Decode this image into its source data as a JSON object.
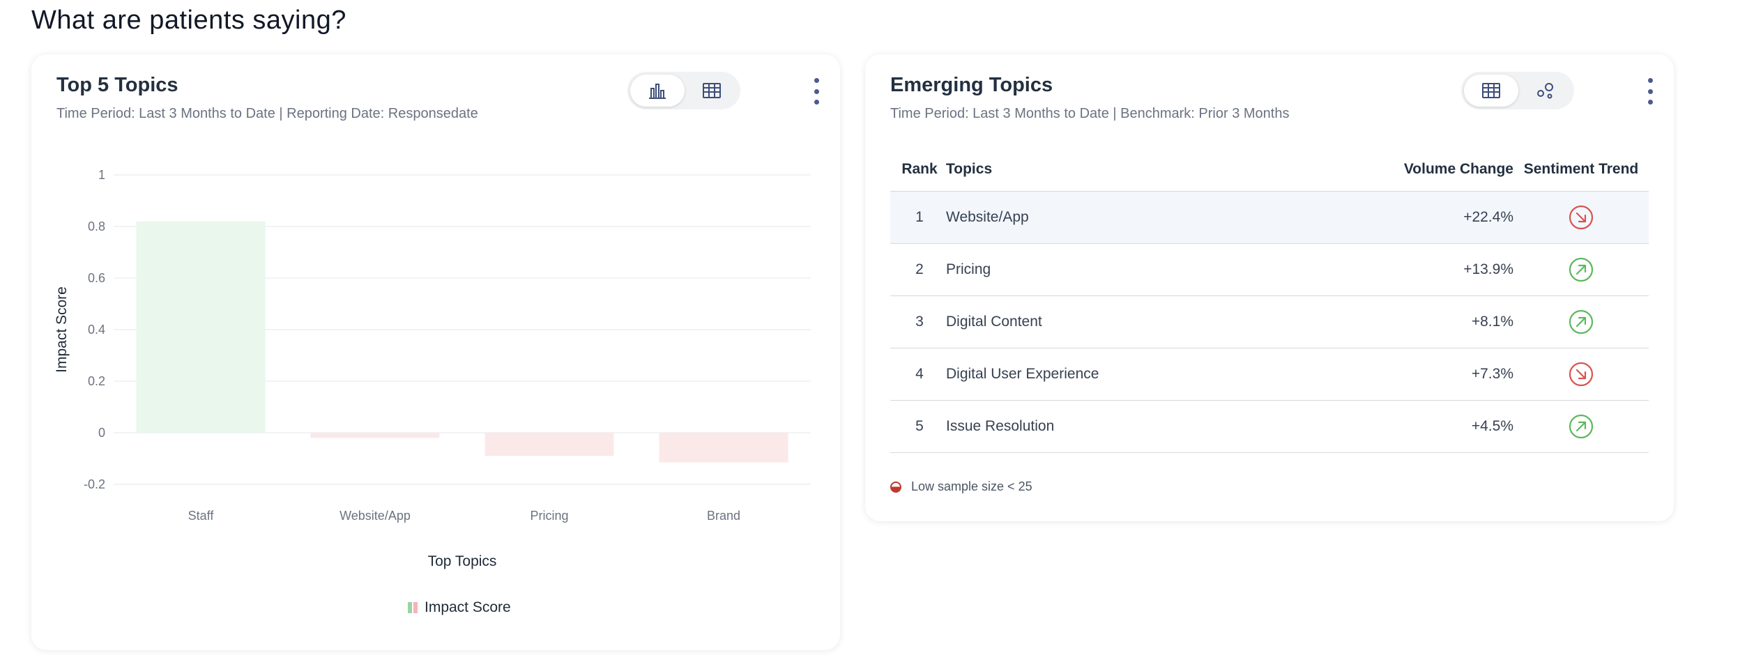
{
  "page": {
    "title": "What are patients saying?"
  },
  "top_topics": {
    "title": "Top 5 Topics",
    "subtitle": "Time Period: Last 3 Months to Date | Reporting Date: Responsedate",
    "view_toggle": {
      "options": [
        "chart-view",
        "table-view"
      ],
      "selected": "chart-view"
    },
    "legend_label": "Impact Score"
  },
  "chart_data": {
    "type": "bar",
    "categories": [
      "Staff",
      "Website/App",
      "Pricing",
      "Brand"
    ],
    "series": [
      {
        "name": "Impact Score",
        "values": [
          0.82,
          -0.02,
          -0.09,
          -0.115
        ]
      }
    ],
    "xlabel": "Top Topics",
    "ylabel": "Impact Score",
    "ylim": [
      -0.2,
      1
    ],
    "yticks": [
      1,
      0.8,
      0.6,
      0.4,
      0.2,
      0,
      -0.2
    ],
    "ytick_labels": [
      "1",
      "0.8",
      "0.6",
      "0.4",
      "0.2",
      "0",
      "-0.2"
    ],
    "grid": true,
    "legend": "bottom-center",
    "colors": {
      "positive": "#eaf7ec",
      "negative": "#fbe9ea",
      "grid": "#e5e7eb",
      "tick": "#6b7280"
    }
  },
  "emerging_topics": {
    "title": "Emerging Topics",
    "subtitle": "Time Period: Last 3 Months to Date | Benchmark: Prior 3 Months",
    "view_toggle": {
      "options": [
        "table-view",
        "scatter-view"
      ],
      "selected": "table-view"
    },
    "columns": {
      "rank": "Rank",
      "topics": "Topics",
      "volume_change": "Volume Change",
      "sentiment_trend": "Sentiment Trend"
    },
    "rows": [
      {
        "rank": "1",
        "topic": "Website/App",
        "volume_change": "+22.4%",
        "trend": "down"
      },
      {
        "rank": "2",
        "topic": "Pricing",
        "volume_change": "+13.9%",
        "trend": "up"
      },
      {
        "rank": "3",
        "topic": "Digital Content",
        "volume_change": "+8.1%",
        "trend": "up"
      },
      {
        "rank": "4",
        "topic": "Digital User Experience",
        "volume_change": "+7.3%",
        "trend": "down"
      },
      {
        "rank": "5",
        "topic": "Issue Resolution",
        "volume_change": "+4.5%",
        "trend": "up"
      }
    ],
    "footnote": "Low sample size < 25",
    "colors": {
      "trend_up": "#5cb85c",
      "trend_down": "#d9534f"
    }
  }
}
